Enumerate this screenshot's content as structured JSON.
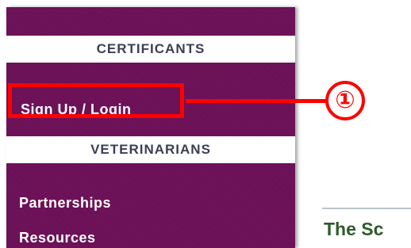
{
  "sidebar": {
    "certificants_header": "CERTIFICANTS",
    "signup_link": "Sign Up / Login",
    "veterinarians_header": "VETERINARIANS",
    "partnerships_link": "Partnerships",
    "resources_link": "Resources"
  },
  "annotation": {
    "badge": "①",
    "color": "#ff0000"
  },
  "content": {
    "title": "The Sc"
  },
  "colors": {
    "sidebar_bg": "#6b0f56",
    "header_text": "#3a3f55",
    "title_text": "#2e5a2c"
  }
}
